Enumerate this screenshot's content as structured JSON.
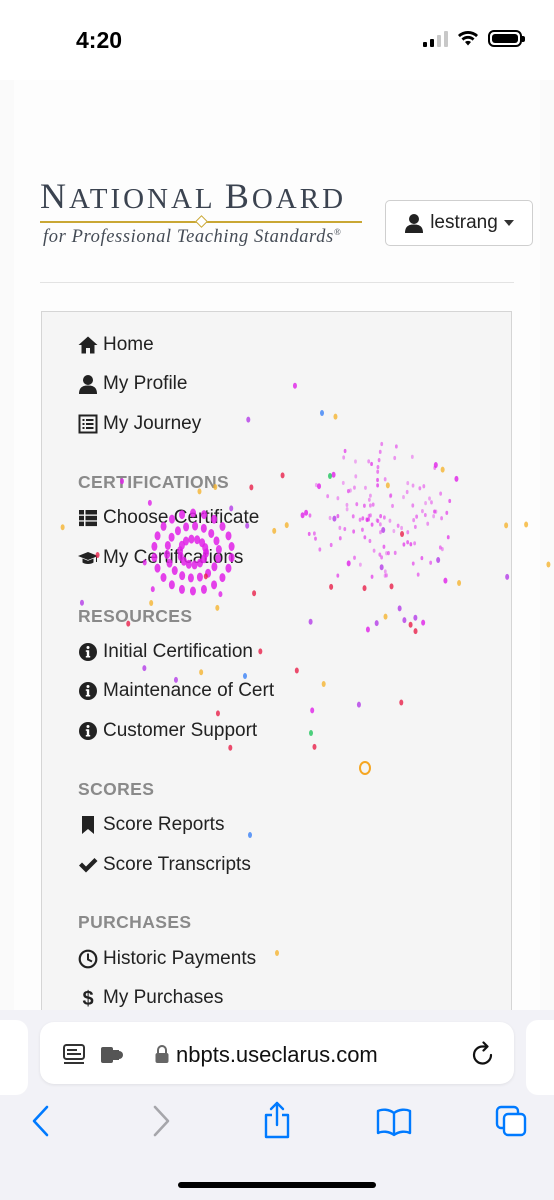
{
  "status_bar": {
    "time": "4:20",
    "icons": [
      "cellular-signal-icon",
      "wifi-icon",
      "battery-icon"
    ]
  },
  "header": {
    "logo": {
      "title_first_initial": "N",
      "title_first_rest": "ATIONAL",
      "title_second_initial": "B",
      "title_second_rest": "OARD",
      "subtitle": "for Professional Teaching Standards",
      "registered_mark": "®"
    },
    "user_menu": {
      "label": "lestrang",
      "icon": "user-icon"
    }
  },
  "nav": {
    "top_items": [
      {
        "label": "Home",
        "icon": "home-icon"
      },
      {
        "label": "My Profile",
        "icon": "user-icon"
      },
      {
        "label": "My Journey",
        "icon": "list-alt-icon"
      }
    ],
    "certifications": {
      "heading": "CERTIFICATIONS",
      "items": [
        {
          "label": "Choose Certificate",
          "icon": "th-list-icon"
        },
        {
          "label": "My Certifications",
          "icon": "graduation-cap-icon"
        }
      ]
    },
    "resources": {
      "heading": "RESOURCES",
      "items": [
        {
          "label": "Initial Certification",
          "icon": "info-icon"
        },
        {
          "label": "Maintenance of Cert",
          "icon": "info-icon"
        },
        {
          "label": "Customer Support",
          "icon": "info-icon"
        }
      ]
    },
    "scores": {
      "heading": "SCORES",
      "items": [
        {
          "label": "Score Reports",
          "icon": "bookmark-icon"
        },
        {
          "label": "Score Transcripts",
          "icon": "check-icon"
        }
      ]
    },
    "purchases": {
      "heading": "PURCHASES",
      "items": [
        {
          "label": "Historic Payments",
          "icon": "clock-icon"
        },
        {
          "label": "My Purchases",
          "icon": "dollar-icon"
        }
      ]
    }
  },
  "browser": {
    "url": "nbpts.useclarus.com",
    "toolbar": [
      "back-icon",
      "forward-icon",
      "share-icon",
      "bookmarks-icon",
      "tabs-icon"
    ]
  },
  "colors": {
    "logo_gold": "#c9a734",
    "heading_gray": "#8a8a8a",
    "ios_blue": "#007aff",
    "firework_magenta": "#e020e8",
    "firework_red": "#e8204a"
  }
}
